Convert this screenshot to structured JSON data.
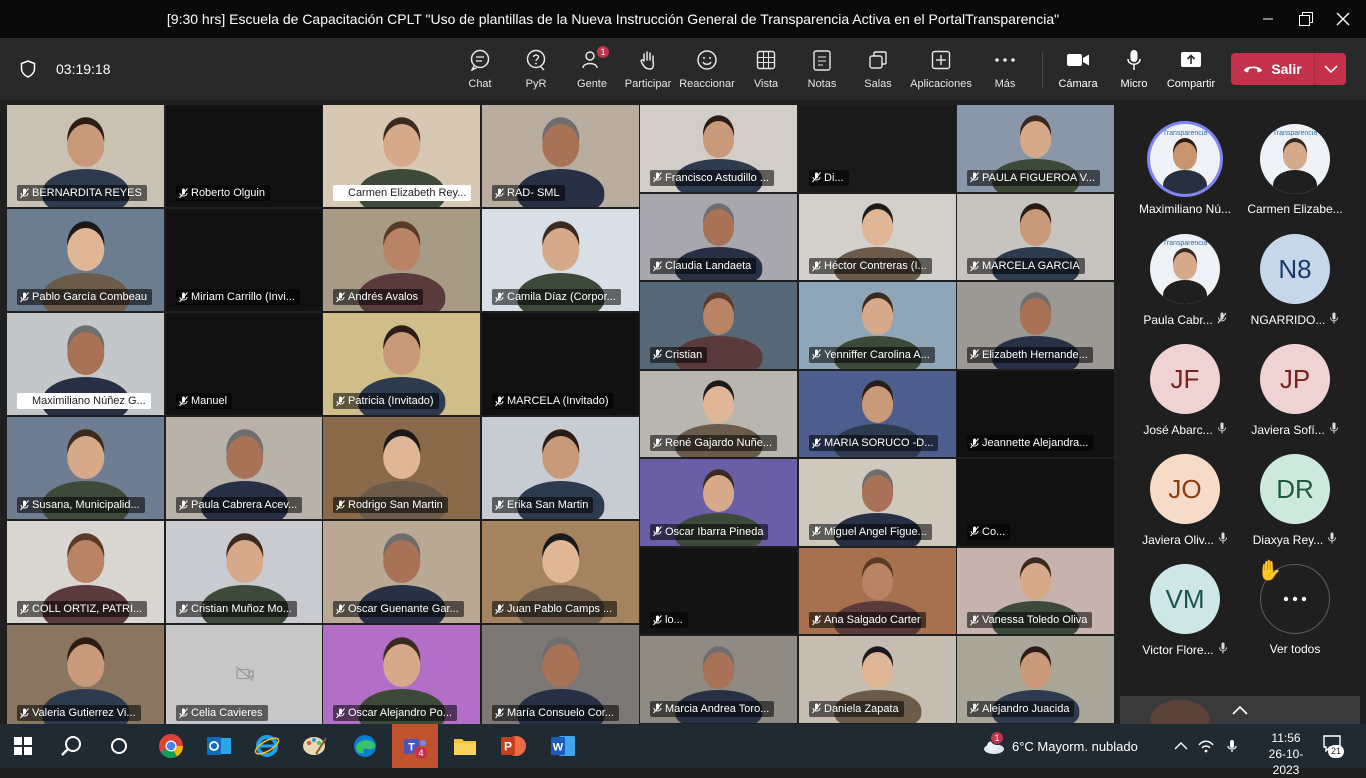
{
  "window": {
    "title": "[9:30 hrs] Escuela de Capacitación CPLT \"Uso de plantillas de la Nueva Instrucción General de Transparencia Activa en el PortalTransparencia\""
  },
  "toolbar": {
    "timer": "03:19:18",
    "buttons": [
      {
        "label": "Chat",
        "icon": "chat-icon"
      },
      {
        "label": "PyR",
        "icon": "qa-icon"
      },
      {
        "label": "Gente",
        "icon": "people-icon",
        "badge": "1"
      },
      {
        "label": "Participar",
        "icon": "raise-hand-icon"
      },
      {
        "label": "Reaccionar",
        "icon": "smile-icon"
      },
      {
        "label": "Vista",
        "icon": "grid-view-icon"
      },
      {
        "label": "Notas",
        "icon": "notes-icon"
      },
      {
        "label": "Salas",
        "icon": "rooms-icon"
      },
      {
        "label": "Aplicaciones",
        "icon": "apps-plus-icon"
      },
      {
        "label": "Más",
        "icon": "more-icon"
      },
      {
        "label": "Cámara",
        "icon": "camera-icon"
      },
      {
        "label": "Micro",
        "icon": "mic-icon"
      },
      {
        "label": "Compartir",
        "icon": "share-icon"
      }
    ],
    "leave": {
      "label": "Salir",
      "color": "#c4314b"
    }
  },
  "gallery": {
    "left_tiles": [
      "BERNARDITA REYES",
      "Roberto Olguin",
      "Carmen Elizabeth Rey...",
      "RAD- SML",
      "Pablo García Combeau",
      "Miriam Carrillo (Invi...",
      "Andrés Avalos",
      "Camila Díaz (Corpor...",
      "Maximiliano Núñez G...",
      "Manuel",
      "Patricia (Invitado)",
      "MARCELA (Invitado)",
      "Susana, Municipalid...",
      "Paula Cabrera Acev...",
      "Rodrigo San Martin",
      "Erika San Martin",
      "COLL ORTIZ, PATRI...",
      "Cristian Muñoz Mo...",
      "Oscar Guenante Gar...",
      "Juan Pablo Camps ...",
      "Valeria Gutierrez Vi...",
      "Celia Cavieres",
      "Oscar Alejandro Po...",
      "María Consuelo Cor..."
    ],
    "right_tiles": [
      "Francisco Astudillo ...",
      "Di...",
      "PAULA FIGUEROA V...",
      "Claudia Landaeta",
      "Héctor Contreras (I...",
      "MARCELA GARCIA",
      "Cristian",
      "Yenniffer Carolina A...",
      "Elizabeth Hernande...",
      "René Gajardo Nuñe...",
      "MARIA SORUCO -D...",
      "Jeannette Alejandra...",
      "Oscar Ibarra Pineda",
      "Miguel Angel Figue...",
      "Co...",
      "lo...",
      "Ana Salgado Carter",
      "Vanessa Toledo Oliva",
      "Marcia Andrea Toro...",
      "Daniela Zapata",
      "Alejandro Juacida"
    ]
  },
  "panel": {
    "participants": [
      {
        "name": "Maximiliano Nú...",
        "initials": "",
        "type": "photo",
        "speaking": true
      },
      {
        "name": "Carmen Elizabe...",
        "initials": "",
        "type": "photo"
      },
      {
        "name": "Paula Cabr...",
        "initials": "",
        "type": "photo",
        "muted": true
      },
      {
        "name": "NGARRIDO...",
        "initials": "N8",
        "bg": "#c7d7ea",
        "fg": "#1b3a6b"
      },
      {
        "name": "José Abarc...",
        "initials": "JF",
        "bg": "#efd2d2",
        "fg": "#7b1f1f"
      },
      {
        "name": "Javiera Sofí...",
        "initials": "JP",
        "bg": "#efd2d2",
        "fg": "#7b1f1f"
      },
      {
        "name": "Javiera Oliv...",
        "initials": "JO",
        "bg": "#f6dcc8",
        "fg": "#8a3d12"
      },
      {
        "name": "Diaxya Rey...",
        "initials": "DR",
        "bg": "#cde8dc",
        "fg": "#1e5a3e"
      },
      {
        "name": "Victor Flore...",
        "initials": "VM",
        "bg": "#cfe6e6",
        "fg": "#1c5454"
      },
      {
        "name": "Ver todos",
        "initials": "...",
        "bg": "#1f1f1f",
        "fg": "#fff",
        "hand": true
      }
    ],
    "logo_text": "Transparencia"
  },
  "taskbar": {
    "weather": "6°C  Mayorm. nublado",
    "weather_badge": "1",
    "teams_badge": "4",
    "time": "11:56",
    "date": "26-10-2023",
    "notifications": "21"
  }
}
